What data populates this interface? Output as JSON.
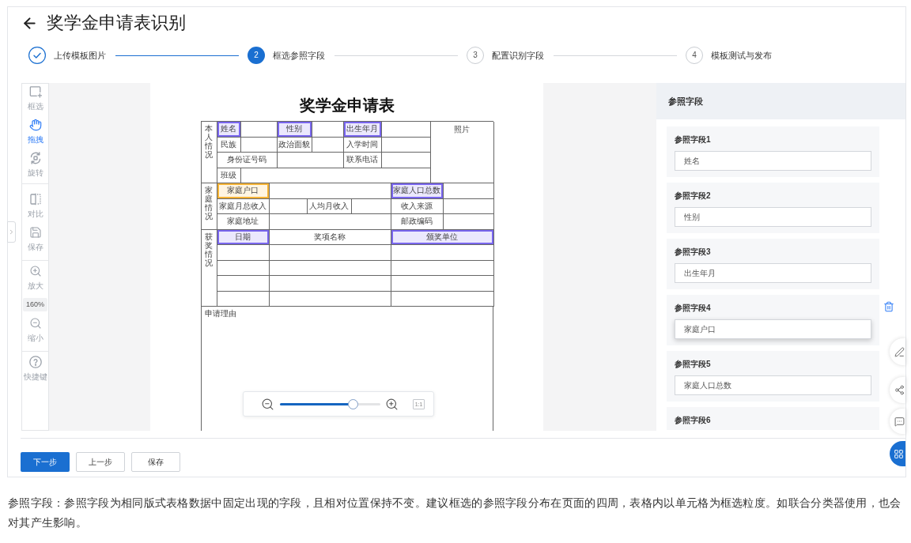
{
  "header": {
    "title": "奖学金申请表识别"
  },
  "steps": [
    {
      "label": "上传模板图片",
      "completed": true,
      "selected": false
    },
    {
      "number": "2",
      "label": "框选参照字段",
      "completed": false,
      "selected": true
    },
    {
      "number": "3",
      "label": "配置识别字段",
      "completed": false,
      "selected": false
    },
    {
      "number": "4",
      "label": "模板测试与发布",
      "completed": false,
      "selected": false
    }
  ],
  "toolbar": {
    "groups": [
      {
        "items": [
          {
            "kind": "tool",
            "label": "框选",
            "selected": false
          },
          {
            "kind": "tool",
            "label": "拖拽",
            "selected": true
          },
          {
            "kind": "tool",
            "label": "旋转",
            "selected": false
          }
        ]
      },
      {
        "items": [
          {
            "kind": "tool",
            "label": "对比",
            "selected": false
          },
          {
            "kind": "tool",
            "label": "保存",
            "selected": false
          }
        ]
      },
      {
        "items": [
          {
            "kind": "tool",
            "label": "放大",
            "selected": false
          },
          {
            "kind": "reading",
            "label": "160%"
          },
          {
            "kind": "tool",
            "label": "缩小",
            "selected": false
          }
        ]
      },
      {
        "items": [
          {
            "kind": "tool",
            "label": "快捷键",
            "selected": false
          }
        ]
      }
    ]
  },
  "form": {
    "title": "奖学金申请表",
    "sections": [
      {
        "heading": "本人情况",
        "cells": [
          {
            "text": "姓名",
            "boxed": true,
            "active": false
          },
          {
            "text": "性别",
            "boxed": true,
            "active": false
          },
          {
            "text": "出生年月",
            "boxed": true,
            "active": false
          },
          {
            "text": "照片",
            "boxed": false,
            "active": false
          },
          {
            "text": "民族",
            "boxed": false,
            "active": false
          },
          {
            "text": "政治面貌",
            "boxed": false,
            "active": false
          },
          {
            "text": "入学时间",
            "boxed": false,
            "active": false
          },
          {
            "text": "身份证号码",
            "boxed": false,
            "active": false
          },
          {
            "text": "联系电话",
            "boxed": false,
            "active": false
          },
          {
            "text": "班级",
            "boxed": false,
            "active": false
          }
        ]
      },
      {
        "heading": "家庭情况",
        "cells": [
          {
            "text": "家庭户口",
            "boxed": true,
            "active": true
          },
          {
            "text": "家庭人口总数",
            "boxed": true,
            "active": false
          },
          {
            "text": "家庭月总收入",
            "boxed": false,
            "active": false
          },
          {
            "text": "人均月收入",
            "boxed": false,
            "active": false
          },
          {
            "text": "收入来源",
            "boxed": false,
            "active": false
          },
          {
            "text": "家庭地址",
            "boxed": false,
            "active": false
          },
          {
            "text": "邮政编码",
            "boxed": false,
            "active": false
          }
        ]
      },
      {
        "heading": "获奖情况",
        "cells": [
          {
            "text": "日期",
            "boxed": true,
            "active": false
          },
          {
            "text": "奖项名称",
            "boxed": false,
            "active": false
          },
          {
            "text": "颁奖单位",
            "boxed": true,
            "active": false
          }
        ]
      }
    ],
    "reason_label": "申请理由"
  },
  "zoom": {
    "level": 0.73,
    "fit_label": "1:1"
  },
  "panel": {
    "title": "参照字段",
    "fields": [
      {
        "label": "参照字段1",
        "value": "姓名",
        "active": false
      },
      {
        "label": "参照字段2",
        "value": "性别",
        "active": false
      },
      {
        "label": "参照字段3",
        "value": "出生年月",
        "active": false
      },
      {
        "label": "参照字段4",
        "value": "家庭户口",
        "active": true
      },
      {
        "label": "参照字段5",
        "value": "家庭人口总数",
        "active": false
      },
      {
        "label": "参照字段6",
        "active": false
      }
    ]
  },
  "actions": [
    {
      "label": "下一步",
      "primary": true
    },
    {
      "label": "上一步",
      "primary": false
    },
    {
      "label": "保存",
      "primary": false
    }
  ],
  "help_text": "参照字段：参照字段为相同版式表格数据中固定出现的字段，且相对位置保持不变。建议框选的参照字段分布在页面的四周，表格内以单元格为框选粒度。如联合分类器使用，也会对其产生影响。"
}
